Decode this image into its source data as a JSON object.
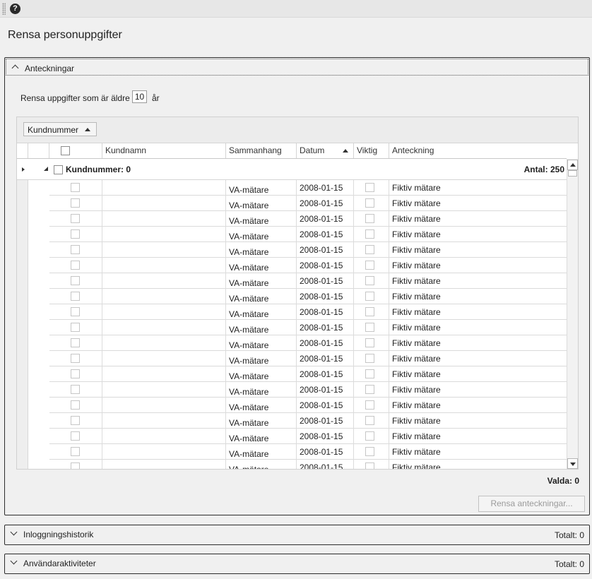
{
  "page_title": "Rensa personuppgifter",
  "panels": {
    "notes": {
      "title": "Anteckningar",
      "filter": {
        "label": "Rensa uppgifter som är äldre än",
        "value": "10",
        "unit": "år"
      },
      "group_by": "Kundnummer",
      "columns": [
        "Kundnamn",
        "Sammanhang",
        "Datum",
        "Viktig",
        "Anteckning"
      ],
      "group": {
        "label": "Kundnummer: 0",
        "count": "Antal: 250"
      },
      "row_template": {
        "kundnamn": "",
        "sammanhang": "VA-mätare",
        "datum": "2008-01-15",
        "anteckning": "Fiktiv mätare"
      },
      "visible_row_count": 19,
      "selected": "Valda: 0",
      "clear_button": "Rensa anteckningar..."
    },
    "login_history": {
      "title": "Inloggningshistorik",
      "total": "Totalt: 0"
    },
    "user_activity": {
      "title": "Användaraktiviteter",
      "total": "Totalt: 0"
    }
  },
  "icons": {
    "help": "help-icon",
    "grip": "grip-icon"
  }
}
